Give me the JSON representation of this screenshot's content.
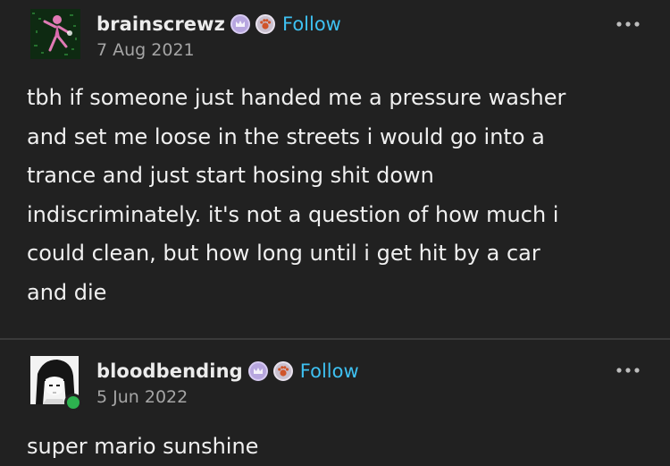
{
  "posts": [
    {
      "username": "brainscrewz",
      "follow_label": "Follow",
      "date": "7 Aug 2021",
      "avatar_icon": "dancer-avatar-icon",
      "badges": [
        "crown-badge-icon",
        "paw-badge-icon"
      ],
      "menu_icon": "more-options-icon",
      "text": "tbh if someone just handed me a pressure washer\nand set me loose in the streets i would go into a\ntrance and just start hosing shit down\nindiscriminately. it's not a question of how much i\ncould clean, but how long until i get hit by a car\nand die"
    },
    {
      "username": "bloodbending",
      "follow_label": "Follow",
      "date": "5 Jun 2022",
      "avatar_icon": "anime-girl-avatar-icon",
      "badges": [
        "crown-badge-icon",
        "paw-badge-icon"
      ],
      "menu_icon": "more-options-icon",
      "online_indicator": "online-status-icon",
      "text": "super mario sunshine"
    }
  ],
  "colors": {
    "background": "#212121",
    "follow": "#3ec1f2",
    "text": "#f0f0f0",
    "date": "#a5a5a5",
    "online": "#2db24f"
  }
}
